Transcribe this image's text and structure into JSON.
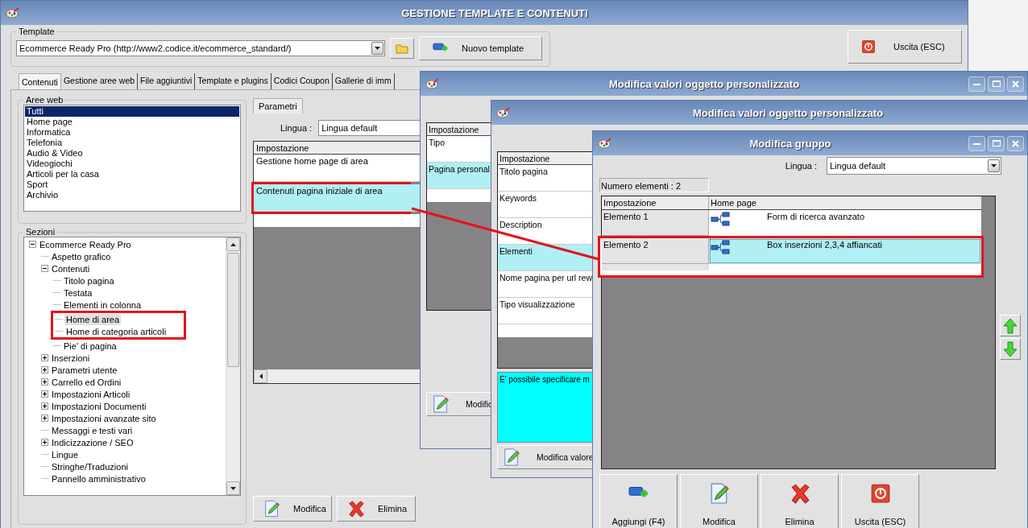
{
  "main_window": {
    "title": "GESTIONE TEMPLATE E CONTENUTI",
    "template": {
      "legend": "Template",
      "value": "Ecommerce Ready Pro (http://www2.codice.it/ecommerce_standard/)",
      "new_button": "Nuovo template"
    },
    "exit_button": "Uscita (ESC)",
    "tabs": [
      {
        "label": "Contenuti",
        "selected": true
      },
      {
        "label": "Gestione aree web",
        "selected": false
      },
      {
        "label": "File aggiuntivi",
        "selected": false
      },
      {
        "label": "Template e plugins",
        "selected": false
      },
      {
        "label": "Codici Coupon",
        "selected": false
      },
      {
        "label": "Gallerie di imm",
        "selected": false
      }
    ],
    "areas": {
      "legend": "Aree web",
      "items": [
        {
          "label": "Tutti",
          "selected": true
        },
        {
          "label": "Home page",
          "selected": false
        },
        {
          "label": "Informatica",
          "selected": false
        },
        {
          "label": "Telefonia",
          "selected": false
        },
        {
          "label": "Audio & Video",
          "selected": false
        },
        {
          "label": "Videogiochi",
          "selected": false
        },
        {
          "label": "Articoli per la casa",
          "selected": false
        },
        {
          "label": "Sport",
          "selected": false
        },
        {
          "label": "Archivio",
          "selected": false
        }
      ]
    },
    "sections": {
      "legend": "Sezioni",
      "tree": [
        {
          "label": "Ecommerce Ready Pro",
          "kind": "folder",
          "expanded": true,
          "selected": false,
          "annotated": false,
          "children": [
            {
              "label": "Aspetto grafico",
              "kind": "leaf",
              "selected": false,
              "annotated": false
            },
            {
              "label": "Contenuti",
              "kind": "folder",
              "expanded": true,
              "selected": false,
              "annotated": false,
              "children": [
                {
                  "label": "Titolo pagina",
                  "kind": "leaf",
                  "selected": false,
                  "annotated": false
                },
                {
                  "label": "Testata",
                  "kind": "leaf",
                  "selected": false,
                  "annotated": false
                },
                {
                  "label": "Elementi in colonna",
                  "kind": "leaf",
                  "selected": false,
                  "annotated": false
                },
                {
                  "label": "Home di area",
                  "kind": "leaf",
                  "selected": true,
                  "annotated": true
                },
                {
                  "label": "Home di categoria articoli",
                  "kind": "leaf",
                  "selected": false,
                  "annotated": true
                },
                {
                  "label": "Pie' di pagina",
                  "kind": "leaf",
                  "selected": false,
                  "annotated": false
                }
              ]
            },
            {
              "label": "Inserzioni",
              "kind": "folder",
              "expanded": false,
              "selected": false,
              "annotated": false
            },
            {
              "label": "Parametri utente",
              "kind": "folder",
              "expanded": false,
              "selected": false,
              "annotated": false
            },
            {
              "label": "Carrello ed Ordini",
              "kind": "folder",
              "expanded": false,
              "selected": false,
              "annotated": false
            },
            {
              "label": "Impostazioni Articoli",
              "kind": "folder",
              "expanded": false,
              "selected": false,
              "annotated": false
            },
            {
              "label": "Impostazioni Documenti",
              "kind": "folder",
              "expanded": false,
              "selected": false,
              "annotated": false
            },
            {
              "label": "Impostazioni avanzate sito",
              "kind": "folder",
              "expanded": false,
              "selected": false,
              "annotated": false
            },
            {
              "label": "Messaggi e testi vari",
              "kind": "leaf",
              "selected": false,
              "annotated": false
            },
            {
              "label": "Indicizzazione / SEO",
              "kind": "folder",
              "expanded": false,
              "selected": false,
              "annotated": false
            },
            {
              "label": "Lingue",
              "kind": "leaf",
              "selected": false,
              "annotated": false
            },
            {
              "label": "Stringhe/Traduzioni",
              "kind": "leaf",
              "selected": false,
              "annotated": false
            },
            {
              "label": "Pannello amministrativo",
              "kind": "leaf",
              "selected": false,
              "annotated": false
            }
          ]
        }
      ]
    },
    "parameters": {
      "tab": "Parametri",
      "language_label": "Lingua :",
      "language": "Lingua default",
      "column": "Impostazione",
      "rows": [
        {
          "text": "Gestione home page di area",
          "selected": false,
          "annotated": false
        },
        {
          "text": "Contenuti pagina iniziale di area",
          "selected": true,
          "annotated": true
        }
      ]
    },
    "buttons": [
      {
        "label": "Modifica",
        "kind": "edit"
      },
      {
        "label": "Elimina",
        "kind": "delete"
      }
    ]
  },
  "object_window_1": {
    "title": "Modifica valori oggetto personalizzato",
    "column": "Impostazione",
    "rows": [
      {
        "text": "Tipo",
        "selected": false
      },
      {
        "text": "Pagina personal",
        "selected": true
      }
    ],
    "button": {
      "label": "Modific",
      "kind": "edit"
    }
  },
  "object_window_2": {
    "title": "Modifica valori oggetto personalizzato",
    "column": "Impostazione",
    "rows": [
      {
        "text": "Titolo pagina",
        "selected": false
      },
      {
        "text": "Keywords",
        "selected": false
      },
      {
        "text": "Description",
        "selected": false
      },
      {
        "text": "Elementi",
        "selected": true
      },
      {
        "text": "Nome pagina per url rew",
        "selected": false
      },
      {
        "text": "Tipo visualizzazione",
        "selected": false
      }
    ],
    "description": "E' possibile specificare m",
    "button": {
      "label": "Modifica valore",
      "kind": "edit"
    }
  },
  "group_window": {
    "title": "Modifica gruppo",
    "language_label": "Lingua :",
    "language": "Lingua default",
    "count": "Numero elementi : 2",
    "columns": [
      "Impostazione",
      "Home page"
    ],
    "rows": [
      {
        "name": "Elemento 1",
        "value": "Form di ricerca avanzato",
        "selected": false,
        "annotated": false
      },
      {
        "name": "Elemento 2",
        "value": "Box inserzioni 2,3,4 affiancati",
        "selected": true,
        "annotated": true
      }
    ],
    "buttons": [
      {
        "label": "Aggiungi (F4)",
        "kind": "add"
      },
      {
        "label": "Modifica",
        "kind": "edit"
      },
      {
        "label": "Elimina",
        "kind": "delete"
      },
      {
        "label": "Uscita (ESC)",
        "kind": "exit"
      }
    ]
  }
}
